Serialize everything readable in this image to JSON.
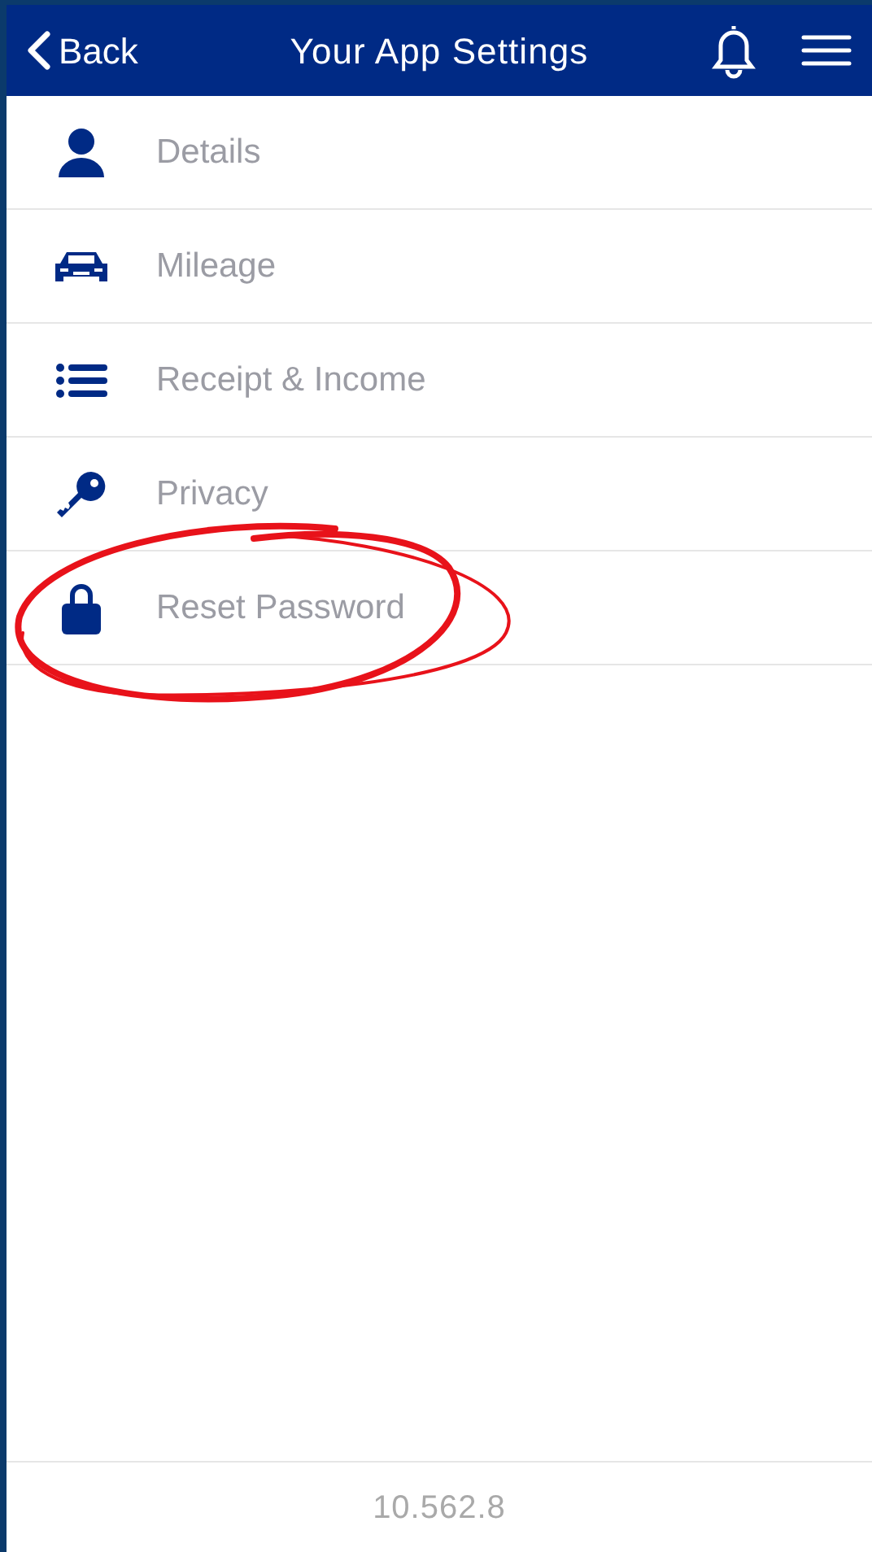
{
  "header": {
    "back": "Back",
    "title": "Your App Settings"
  },
  "menu": [
    {
      "label": "Details",
      "kind": "person",
      "circled": false
    },
    {
      "label": "Mileage",
      "kind": "car",
      "circled": false
    },
    {
      "label": "Receipt & Income",
      "kind": "list",
      "circled": false
    },
    {
      "label": "Privacy",
      "kind": "key",
      "circled": false
    },
    {
      "label": "Reset Password",
      "kind": "lock",
      "circled": true
    }
  ],
  "version": "10.562.8"
}
